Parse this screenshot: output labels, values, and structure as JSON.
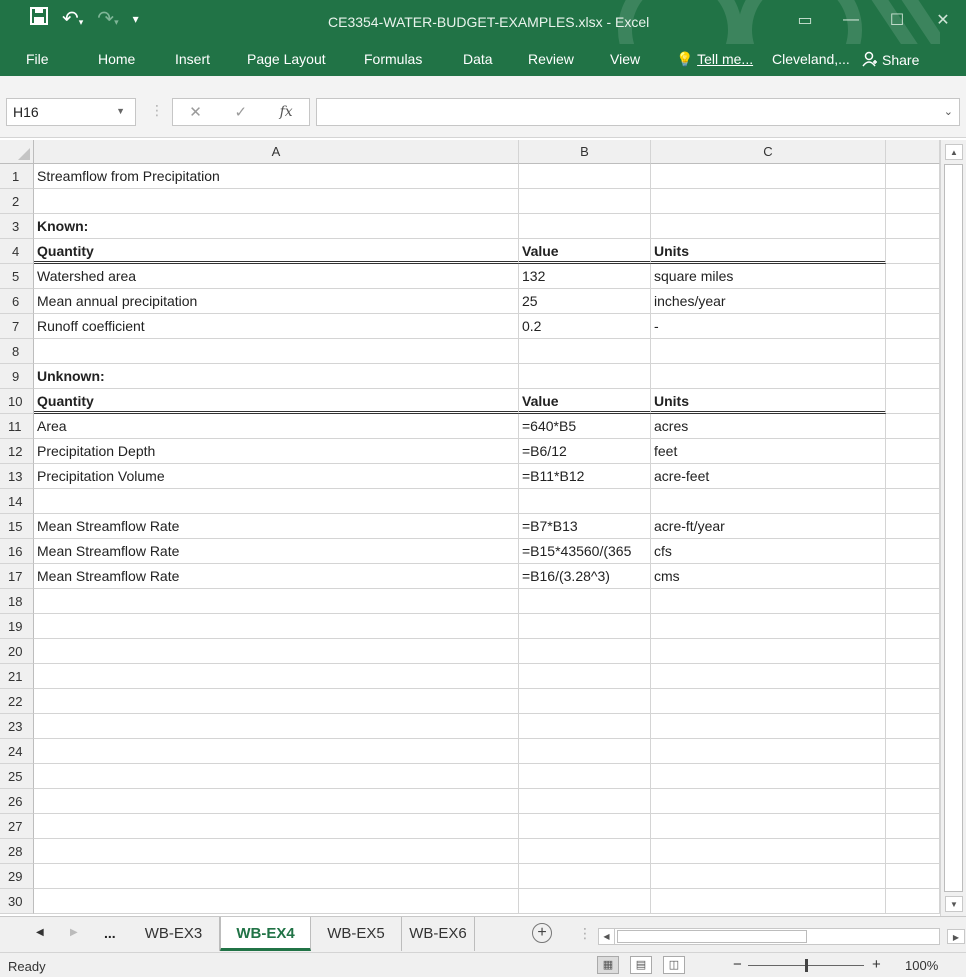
{
  "window": {
    "doc_title": "CE3354-WATER-BUDGET-EXAMPLES.xlsx - Excel"
  },
  "ribbon": {
    "tabs": [
      "File",
      "Home",
      "Insert",
      "Page Layout",
      "Formulas",
      "Data",
      "Review",
      "View"
    ],
    "tell_me": "Tell me...",
    "user": "Cleveland,...",
    "share": "Share"
  },
  "formula_bar": {
    "name_box": "H16",
    "formula": ""
  },
  "columns": [
    "A",
    "B",
    "C"
  ],
  "rows": [
    {
      "n": "1",
      "a": "Streamflow from Precipitation",
      "b": "",
      "c": "",
      "bold": false,
      "dbl": false
    },
    {
      "n": "2",
      "a": "",
      "b": "",
      "c": "",
      "bold": false,
      "dbl": false
    },
    {
      "n": "3",
      "a": "Known:",
      "b": "",
      "c": "",
      "bold": true,
      "dbl": false
    },
    {
      "n": "4",
      "a": "Quantity",
      "b": "Value",
      "c": "Units",
      "bold": true,
      "dbl": true
    },
    {
      "n": "5",
      "a": "Watershed area",
      "b": "132",
      "c": "square miles",
      "bold": false,
      "dbl": false
    },
    {
      "n": "6",
      "a": "Mean annual precipitation",
      "b": "25",
      "c": "inches/year",
      "bold": false,
      "dbl": false
    },
    {
      "n": "7",
      "a": "Runoff coefficient",
      "b": "0.2",
      "c": "-",
      "bold": false,
      "dbl": false
    },
    {
      "n": "8",
      "a": "",
      "b": "",
      "c": "",
      "bold": false,
      "dbl": false
    },
    {
      "n": "9",
      "a": "Unknown:",
      "b": "",
      "c": "",
      "bold": true,
      "dbl": false
    },
    {
      "n": "10",
      "a": "Quantity",
      "b": "Value",
      "c": "Units",
      "bold": true,
      "dbl": true
    },
    {
      "n": "11",
      "a": "Area",
      "b": "=640*B5",
      "c": "acres",
      "bold": false,
      "dbl": false
    },
    {
      "n": "12",
      "a": "Precipitation Depth",
      "b": "=B6/12",
      "c": "feet",
      "bold": false,
      "dbl": false
    },
    {
      "n": "13",
      "a": "Precipitation Volume",
      "b": "=B11*B12",
      "c": "acre-feet",
      "bold": false,
      "dbl": false
    },
    {
      "n": "14",
      "a": "",
      "b": "",
      "c": "",
      "bold": false,
      "dbl": false
    },
    {
      "n": "15",
      "a": "Mean Streamflow Rate",
      "b": "=B7*B13",
      "c": "acre-ft/year",
      "bold": false,
      "dbl": false
    },
    {
      "n": "16",
      "a": "Mean Streamflow Rate",
      "b": "=B15*43560/(365",
      "c": "cfs",
      "bold": false,
      "dbl": false
    },
    {
      "n": "17",
      "a": "Mean Streamflow Rate",
      "b": "=B16/(3.28^3)",
      "c": "cms",
      "bold": false,
      "dbl": false
    },
    {
      "n": "18",
      "a": "",
      "b": "",
      "c": "",
      "bold": false,
      "dbl": false
    },
    {
      "n": "19",
      "a": "",
      "b": "",
      "c": "",
      "bold": false,
      "dbl": false
    },
    {
      "n": "20",
      "a": "",
      "b": "",
      "c": "",
      "bold": false,
      "dbl": false
    },
    {
      "n": "21",
      "a": "",
      "b": "",
      "c": "",
      "bold": false,
      "dbl": false
    },
    {
      "n": "22",
      "a": "",
      "b": "",
      "c": "",
      "bold": false,
      "dbl": false
    },
    {
      "n": "23",
      "a": "",
      "b": "",
      "c": "",
      "bold": false,
      "dbl": false
    },
    {
      "n": "24",
      "a": "",
      "b": "",
      "c": "",
      "bold": false,
      "dbl": false
    },
    {
      "n": "25",
      "a": "",
      "b": "",
      "c": "",
      "bold": false,
      "dbl": false
    },
    {
      "n": "26",
      "a": "",
      "b": "",
      "c": "",
      "bold": false,
      "dbl": false
    },
    {
      "n": "27",
      "a": "",
      "b": "",
      "c": "",
      "bold": false,
      "dbl": false
    },
    {
      "n": "28",
      "a": "",
      "b": "",
      "c": "",
      "bold": false,
      "dbl": false
    },
    {
      "n": "29",
      "a": "",
      "b": "",
      "c": "",
      "bold": false,
      "dbl": false
    },
    {
      "n": "30",
      "a": "",
      "b": "",
      "c": "",
      "bold": false,
      "dbl": false
    }
  ],
  "sheet_tabs": {
    "overflow": "...",
    "tabs": [
      {
        "label": "WB-EX3",
        "active": false
      },
      {
        "label": "WB-EX4",
        "active": true
      },
      {
        "label": "WB-EX5",
        "active": false
      },
      {
        "label": "WB-EX6",
        "active": false
      }
    ]
  },
  "status": {
    "mode": "Ready",
    "zoom": "100%",
    "zoom_level_percent": 100
  },
  "colors": {
    "accent": "#217346",
    "header_bg": "#f0f0f0",
    "gridline": "#d4d4d4"
  }
}
